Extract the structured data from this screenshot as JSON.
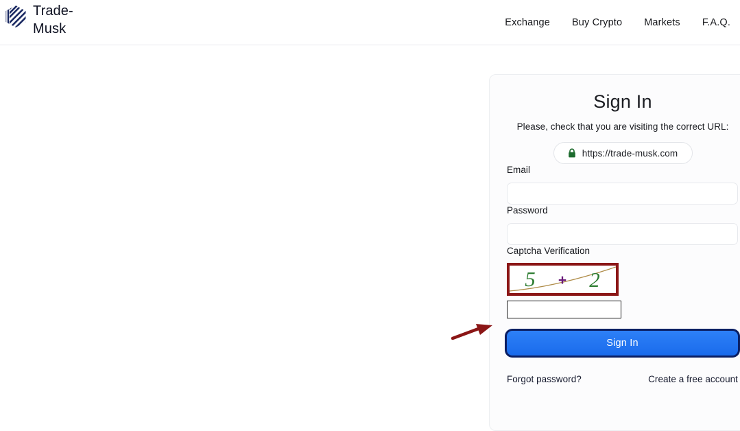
{
  "header": {
    "brand": {
      "name": "Trade-Musk",
      "logo_icon": "hexagon-stripes-logo-icon",
      "logo_color": "#1c2b63"
    },
    "nav": [
      {
        "label": "Exchange",
        "name": "nav-link-exchange"
      },
      {
        "label": "Buy Crypto",
        "name": "nav-link-buy-crypto"
      },
      {
        "label": "Markets",
        "name": "nav-link-markets"
      },
      {
        "label": "F.A.Q.",
        "name": "nav-link-faq"
      }
    ]
  },
  "signin": {
    "title": "Sign In",
    "url_note": "Please, check that you are visiting the correct URL:",
    "url_pill": {
      "text": "https://trade-musk.com",
      "icon": "padlock-icon",
      "icon_color": "#1d6b2e"
    },
    "email": {
      "label": "Email",
      "value": "",
      "placeholder": ""
    },
    "password": {
      "label": "Password",
      "value": "",
      "placeholder": ""
    },
    "captcha": {
      "label": "Captcha Verification",
      "challenge_text": "5 + 2",
      "operand_left": "5",
      "operator": "+",
      "operand_right": "2",
      "digit_color": "#2e7d32",
      "operator_color": "#6a1b7a",
      "noise_line_color": "#b08d4a",
      "border_color": "#8b1616",
      "answer_value": "",
      "answer_placeholder": ""
    },
    "submit_label": "Sign In",
    "forgot_password_label": "Forgot password?",
    "create_account_label": "Create a free account"
  },
  "annotation": {
    "arrow_color": "#8b1616",
    "points_to": "captcha-box"
  }
}
